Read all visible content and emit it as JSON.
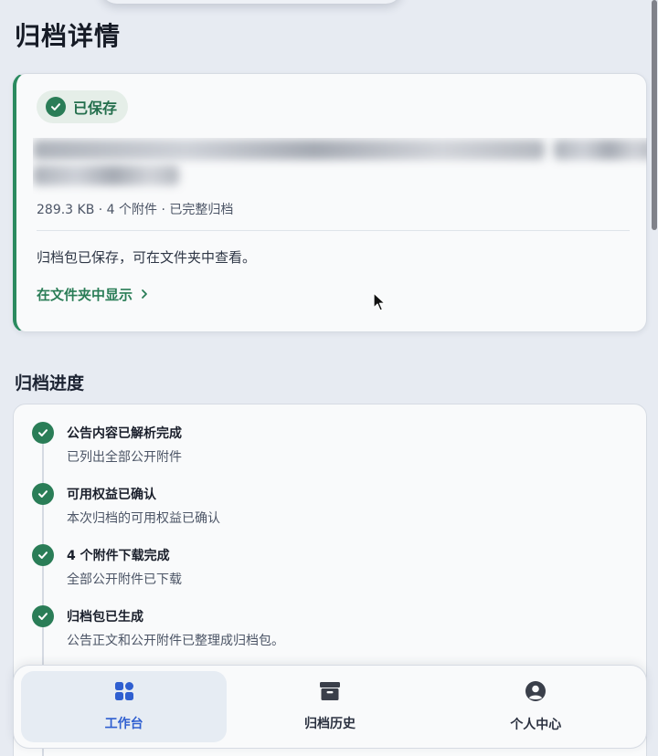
{
  "header": {
    "title": "归档详情"
  },
  "result_card": {
    "badge_label": "已保存",
    "meta": "289.3 KB · 4 个附件 · 已完整归档",
    "note": "归档包已保存，可在文件夹中查看。",
    "link_label": "在文件夹中显示",
    "accent_color": "#2a8a5f"
  },
  "progress": {
    "title": "归档进度",
    "steps": [
      {
        "title": "公告内容已解析完成",
        "desc": "已列出全部公开附件"
      },
      {
        "title": "可用权益已确认",
        "desc": "本次归档的可用权益已确认"
      },
      {
        "title": "4 个附件下载完成",
        "desc": "全部公开附件已下载"
      },
      {
        "title": "归档包已生成",
        "desc": "公告正文和公开附件已整理成归档包。"
      }
    ]
  },
  "tabbar": {
    "tabs": [
      {
        "label": "工作台",
        "icon": "grid-icon",
        "active": true
      },
      {
        "label": "归档历史",
        "icon": "archive-box-icon",
        "active": false
      },
      {
        "label": "个人中心",
        "icon": "user-circle-icon",
        "active": false
      }
    ],
    "active_color": "#2f5fd0"
  }
}
